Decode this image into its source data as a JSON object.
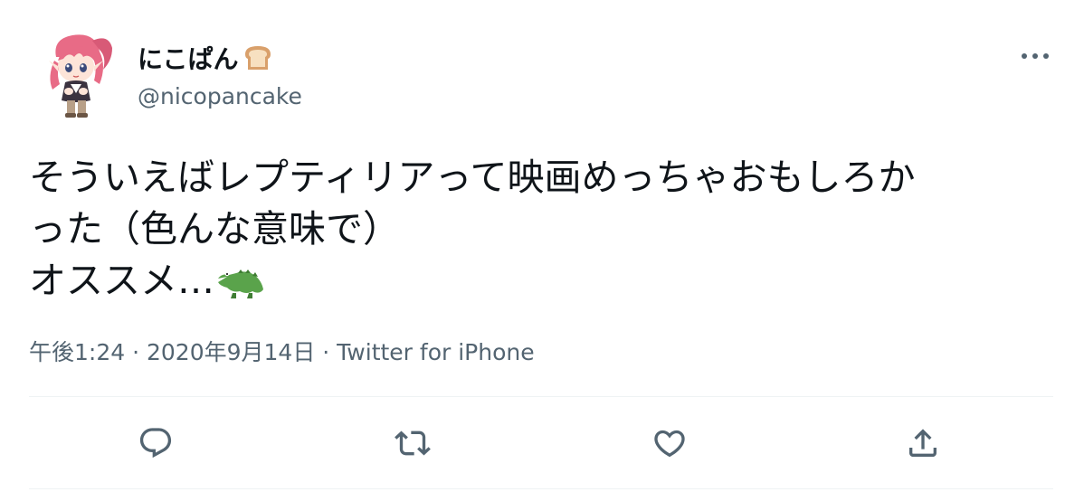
{
  "author": {
    "display_name": "にこぱん",
    "handle": "@nicopancake",
    "avatar_icon": "anime-girl-avatar",
    "name_emoji": "bread-icon"
  },
  "tweet": {
    "lines": [
      "そういえばレプティリアって映画めっちゃおもしろか",
      "った（色んな意味で）",
      "オススメ…"
    ],
    "trailing_emoji": "crocodile-icon"
  },
  "meta": {
    "time": "午後1:24",
    "separator1": " · ",
    "date": "2020年9月14日",
    "separator2": " · ",
    "source": "Twitter for iPhone"
  },
  "actions": {
    "reply": "reply-icon",
    "retweet": "retweet-icon",
    "like": "like-icon",
    "share": "share-icon"
  },
  "colors": {
    "text": "#0f1419",
    "secondary": "#536471",
    "divider": "#eff3f4",
    "icon": "#536471"
  }
}
